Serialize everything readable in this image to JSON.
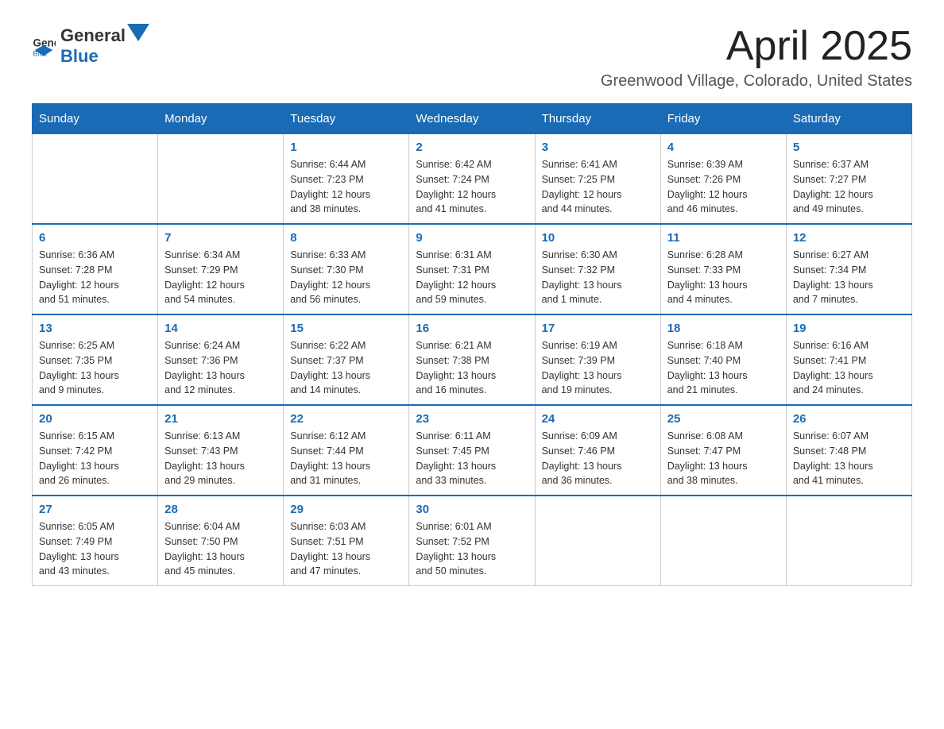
{
  "header": {
    "logo_general": "General",
    "logo_blue": "Blue",
    "month": "April 2025",
    "location": "Greenwood Village, Colorado, United States"
  },
  "days_of_week": [
    "Sunday",
    "Monday",
    "Tuesday",
    "Wednesday",
    "Thursday",
    "Friday",
    "Saturday"
  ],
  "weeks": [
    [
      {
        "day": "",
        "info": ""
      },
      {
        "day": "",
        "info": ""
      },
      {
        "day": "1",
        "info": "Sunrise: 6:44 AM\nSunset: 7:23 PM\nDaylight: 12 hours\nand 38 minutes."
      },
      {
        "day": "2",
        "info": "Sunrise: 6:42 AM\nSunset: 7:24 PM\nDaylight: 12 hours\nand 41 minutes."
      },
      {
        "day": "3",
        "info": "Sunrise: 6:41 AM\nSunset: 7:25 PM\nDaylight: 12 hours\nand 44 minutes."
      },
      {
        "day": "4",
        "info": "Sunrise: 6:39 AM\nSunset: 7:26 PM\nDaylight: 12 hours\nand 46 minutes."
      },
      {
        "day": "5",
        "info": "Sunrise: 6:37 AM\nSunset: 7:27 PM\nDaylight: 12 hours\nand 49 minutes."
      }
    ],
    [
      {
        "day": "6",
        "info": "Sunrise: 6:36 AM\nSunset: 7:28 PM\nDaylight: 12 hours\nand 51 minutes."
      },
      {
        "day": "7",
        "info": "Sunrise: 6:34 AM\nSunset: 7:29 PM\nDaylight: 12 hours\nand 54 minutes."
      },
      {
        "day": "8",
        "info": "Sunrise: 6:33 AM\nSunset: 7:30 PM\nDaylight: 12 hours\nand 56 minutes."
      },
      {
        "day": "9",
        "info": "Sunrise: 6:31 AM\nSunset: 7:31 PM\nDaylight: 12 hours\nand 59 minutes."
      },
      {
        "day": "10",
        "info": "Sunrise: 6:30 AM\nSunset: 7:32 PM\nDaylight: 13 hours\nand 1 minute."
      },
      {
        "day": "11",
        "info": "Sunrise: 6:28 AM\nSunset: 7:33 PM\nDaylight: 13 hours\nand 4 minutes."
      },
      {
        "day": "12",
        "info": "Sunrise: 6:27 AM\nSunset: 7:34 PM\nDaylight: 13 hours\nand 7 minutes."
      }
    ],
    [
      {
        "day": "13",
        "info": "Sunrise: 6:25 AM\nSunset: 7:35 PM\nDaylight: 13 hours\nand 9 minutes."
      },
      {
        "day": "14",
        "info": "Sunrise: 6:24 AM\nSunset: 7:36 PM\nDaylight: 13 hours\nand 12 minutes."
      },
      {
        "day": "15",
        "info": "Sunrise: 6:22 AM\nSunset: 7:37 PM\nDaylight: 13 hours\nand 14 minutes."
      },
      {
        "day": "16",
        "info": "Sunrise: 6:21 AM\nSunset: 7:38 PM\nDaylight: 13 hours\nand 16 minutes."
      },
      {
        "day": "17",
        "info": "Sunrise: 6:19 AM\nSunset: 7:39 PM\nDaylight: 13 hours\nand 19 minutes."
      },
      {
        "day": "18",
        "info": "Sunrise: 6:18 AM\nSunset: 7:40 PM\nDaylight: 13 hours\nand 21 minutes."
      },
      {
        "day": "19",
        "info": "Sunrise: 6:16 AM\nSunset: 7:41 PM\nDaylight: 13 hours\nand 24 minutes."
      }
    ],
    [
      {
        "day": "20",
        "info": "Sunrise: 6:15 AM\nSunset: 7:42 PM\nDaylight: 13 hours\nand 26 minutes."
      },
      {
        "day": "21",
        "info": "Sunrise: 6:13 AM\nSunset: 7:43 PM\nDaylight: 13 hours\nand 29 minutes."
      },
      {
        "day": "22",
        "info": "Sunrise: 6:12 AM\nSunset: 7:44 PM\nDaylight: 13 hours\nand 31 minutes."
      },
      {
        "day": "23",
        "info": "Sunrise: 6:11 AM\nSunset: 7:45 PM\nDaylight: 13 hours\nand 33 minutes."
      },
      {
        "day": "24",
        "info": "Sunrise: 6:09 AM\nSunset: 7:46 PM\nDaylight: 13 hours\nand 36 minutes."
      },
      {
        "day": "25",
        "info": "Sunrise: 6:08 AM\nSunset: 7:47 PM\nDaylight: 13 hours\nand 38 minutes."
      },
      {
        "day": "26",
        "info": "Sunrise: 6:07 AM\nSunset: 7:48 PM\nDaylight: 13 hours\nand 41 minutes."
      }
    ],
    [
      {
        "day": "27",
        "info": "Sunrise: 6:05 AM\nSunset: 7:49 PM\nDaylight: 13 hours\nand 43 minutes."
      },
      {
        "day": "28",
        "info": "Sunrise: 6:04 AM\nSunset: 7:50 PM\nDaylight: 13 hours\nand 45 minutes."
      },
      {
        "day": "29",
        "info": "Sunrise: 6:03 AM\nSunset: 7:51 PM\nDaylight: 13 hours\nand 47 minutes."
      },
      {
        "day": "30",
        "info": "Sunrise: 6:01 AM\nSunset: 7:52 PM\nDaylight: 13 hours\nand 50 minutes."
      },
      {
        "day": "",
        "info": ""
      },
      {
        "day": "",
        "info": ""
      },
      {
        "day": "",
        "info": ""
      }
    ]
  ]
}
